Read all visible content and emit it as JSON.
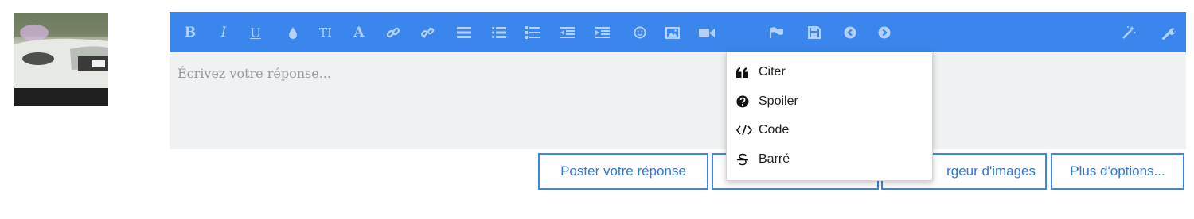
{
  "editor": {
    "placeholder": "Écrivez votre réponse...",
    "toolbar": {
      "bold_label": "B",
      "italic_label": "I",
      "underline_label": "U",
      "font_size_label": "TI",
      "font_color_label": "A"
    },
    "toolbar_color": "#3b86ec",
    "icon_color": "#b3d1fb"
  },
  "dropdown": {
    "items": [
      {
        "label": "Citer",
        "icon": "quote-icon"
      },
      {
        "label": "Spoiler",
        "icon": "question-circle-icon"
      },
      {
        "label": "Code",
        "icon": "code-icon"
      },
      {
        "label": "Barré",
        "icon": "strikethrough-icon"
      }
    ]
  },
  "actions": {
    "post_label": "Poster votre réponse",
    "hidden_label": "",
    "images_label": "rgeur d'images",
    "more_label": "Plus d'options..."
  }
}
